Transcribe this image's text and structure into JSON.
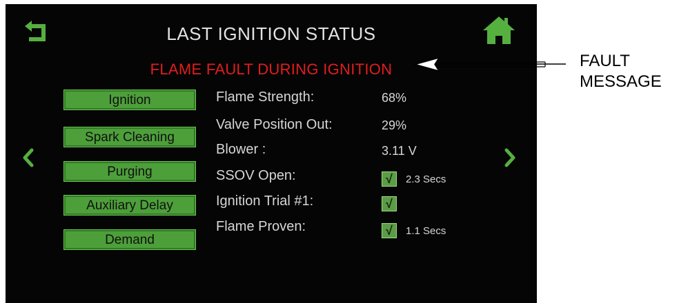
{
  "header": {
    "title": "LAST IGNITION STATUS",
    "fault_message": "FLAME FAULT DURING IGNITION"
  },
  "icons": {
    "back": "back-arrow-icon",
    "home": "home-icon",
    "prev": "chevron-left-icon",
    "next": "chevron-right-icon"
  },
  "colors": {
    "screen_bg": "#050505",
    "button_green": "#4d9f3a",
    "fault_red": "#e31d1d",
    "icon_green": "#56b040"
  },
  "sequence_buttons": [
    "Ignition",
    "Spark Cleaning",
    "Purging",
    "Auxiliary Delay",
    "Demand"
  ],
  "status": {
    "flame_strength": {
      "label": "Flame Strength:",
      "value": "68%"
    },
    "valve_position": {
      "label": "Valve Position Out:",
      "value": "29%"
    },
    "blower": {
      "label": "Blower :",
      "value": "3.11 V"
    },
    "ssov_open": {
      "label": "SSOV Open:",
      "checked": true,
      "time": "2.3 Secs"
    },
    "ignition_trial": {
      "label": "Ignition Trial #1:",
      "checked": true
    },
    "flame_proven": {
      "label": "Flame Proven:",
      "checked": true,
      "time": "1.1 Secs"
    },
    "check_mark": "√"
  },
  "callout": {
    "line1": "FAULT",
    "line2": "MESSAGE"
  }
}
